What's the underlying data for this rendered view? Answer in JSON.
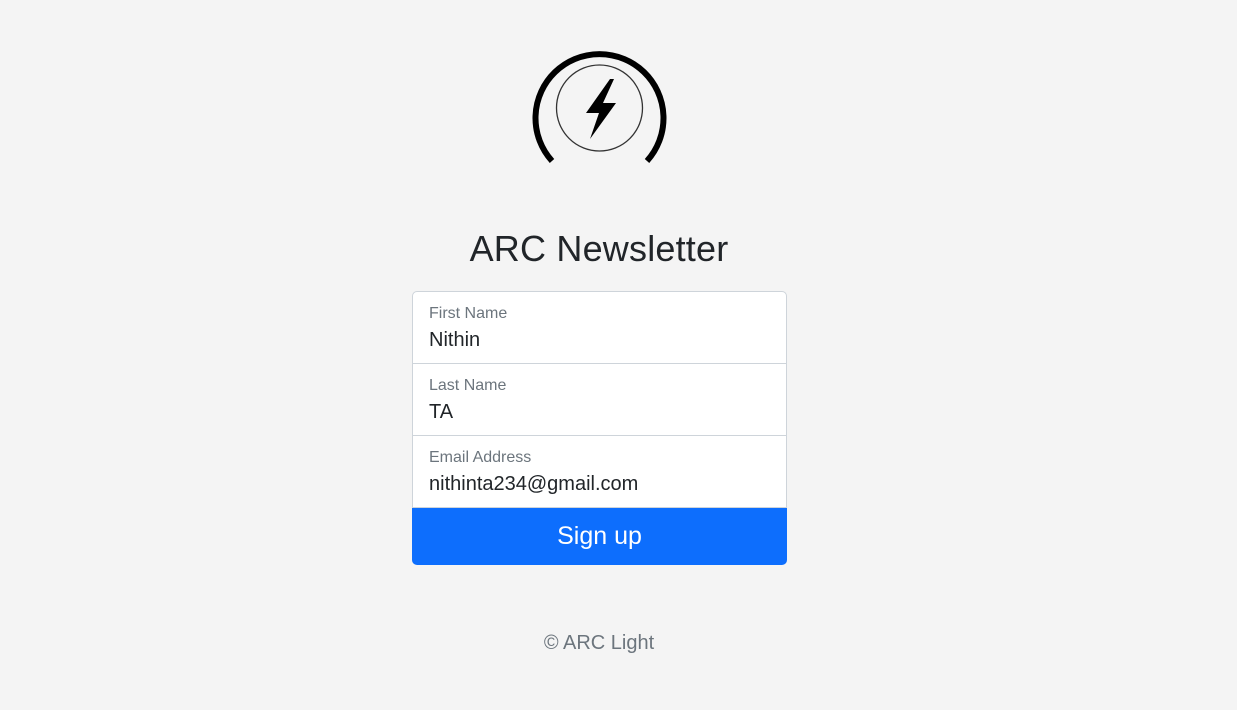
{
  "logo": {
    "icon": "lightning-bolt-icon"
  },
  "title": "ARC Newsletter",
  "form": {
    "first_name": {
      "label": "First Name",
      "value": "Nithin"
    },
    "last_name": {
      "label": "Last Name",
      "value": "TA"
    },
    "email": {
      "label": "Email Address",
      "value": "nithinta234@gmail.com"
    },
    "submit_label": "Sign up"
  },
  "footer": {
    "text": "© ARC Light"
  },
  "colors": {
    "background": "#f4f4f4",
    "primary": "#0d6efd",
    "text": "#212529",
    "muted": "#6c757d"
  }
}
